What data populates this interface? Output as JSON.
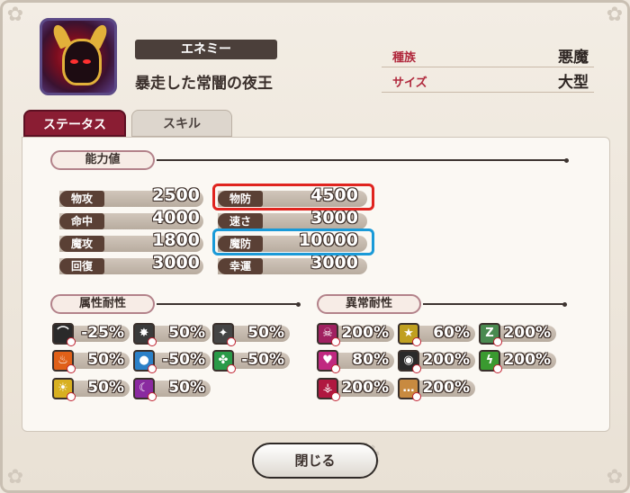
{
  "enemy": {
    "type_label": "エネミー",
    "name": "暴走した常闇の夜王",
    "info": [
      {
        "label": "種族",
        "value": "悪魔"
      },
      {
        "label": "サイズ",
        "value": "大型"
      }
    ]
  },
  "tabs": [
    {
      "label": "ステータス",
      "active": true
    },
    {
      "label": "スキル",
      "active": false
    }
  ],
  "stats": {
    "header": "能力値",
    "left": [
      {
        "label": "物攻",
        "value": "2500"
      },
      {
        "label": "命中",
        "value": "4000"
      },
      {
        "label": "魔攻",
        "value": "1800"
      },
      {
        "label": "回復",
        "value": "3000"
      }
    ],
    "right": [
      {
        "label": "物防",
        "value": "4500",
        "highlight": "#e0241f"
      },
      {
        "label": "速さ",
        "value": "3000"
      },
      {
        "label": "魔防",
        "value": "10000",
        "highlight": "#1a9ad8"
      },
      {
        "label": "幸運",
        "value": "3000"
      }
    ]
  },
  "attribute_resist": {
    "header": "属性耐性",
    "items": [
      {
        "icon": "slash-icon",
        "value": "-25%",
        "color": "#2a2a2a"
      },
      {
        "icon": "burst-icon",
        "value": "50%",
        "color": "#3a3a3a"
      },
      {
        "icon": "spike-icon",
        "value": "50%",
        "color": "#444444"
      },
      {
        "icon": "fire-icon",
        "value": "50%",
        "color": "#e06018"
      },
      {
        "icon": "water-icon",
        "value": "-50%",
        "color": "#2a80c8"
      },
      {
        "icon": "wind-icon",
        "value": "-50%",
        "color": "#2a9a48"
      },
      {
        "icon": "light-icon",
        "value": "50%",
        "color": "#d8b020"
      },
      {
        "icon": "dark-icon",
        "value": "50%",
        "color": "#8a2aa0"
      }
    ]
  },
  "ailment_resist": {
    "header": "異常耐性",
    "items": [
      {
        "icon": "poison-icon",
        "value": "200%",
        "color": "#a02060"
      },
      {
        "icon": "stun-icon",
        "value": "60%",
        "color": "#c0a020"
      },
      {
        "icon": "sleep-icon",
        "value": "200%",
        "color": "#4a8a50"
      },
      {
        "icon": "charm-icon",
        "value": "80%",
        "color": "#c02880"
      },
      {
        "icon": "blind-icon",
        "value": "200%",
        "color": "#2a2a2a"
      },
      {
        "icon": "paralysis-icon",
        "value": "200%",
        "color": "#3a9a30"
      },
      {
        "icon": "curse-icon",
        "value": "200%",
        "color": "#b01840"
      },
      {
        "icon": "silence-icon",
        "value": "200%",
        "color": "#c88a40"
      }
    ]
  },
  "close_button": "閉じる"
}
